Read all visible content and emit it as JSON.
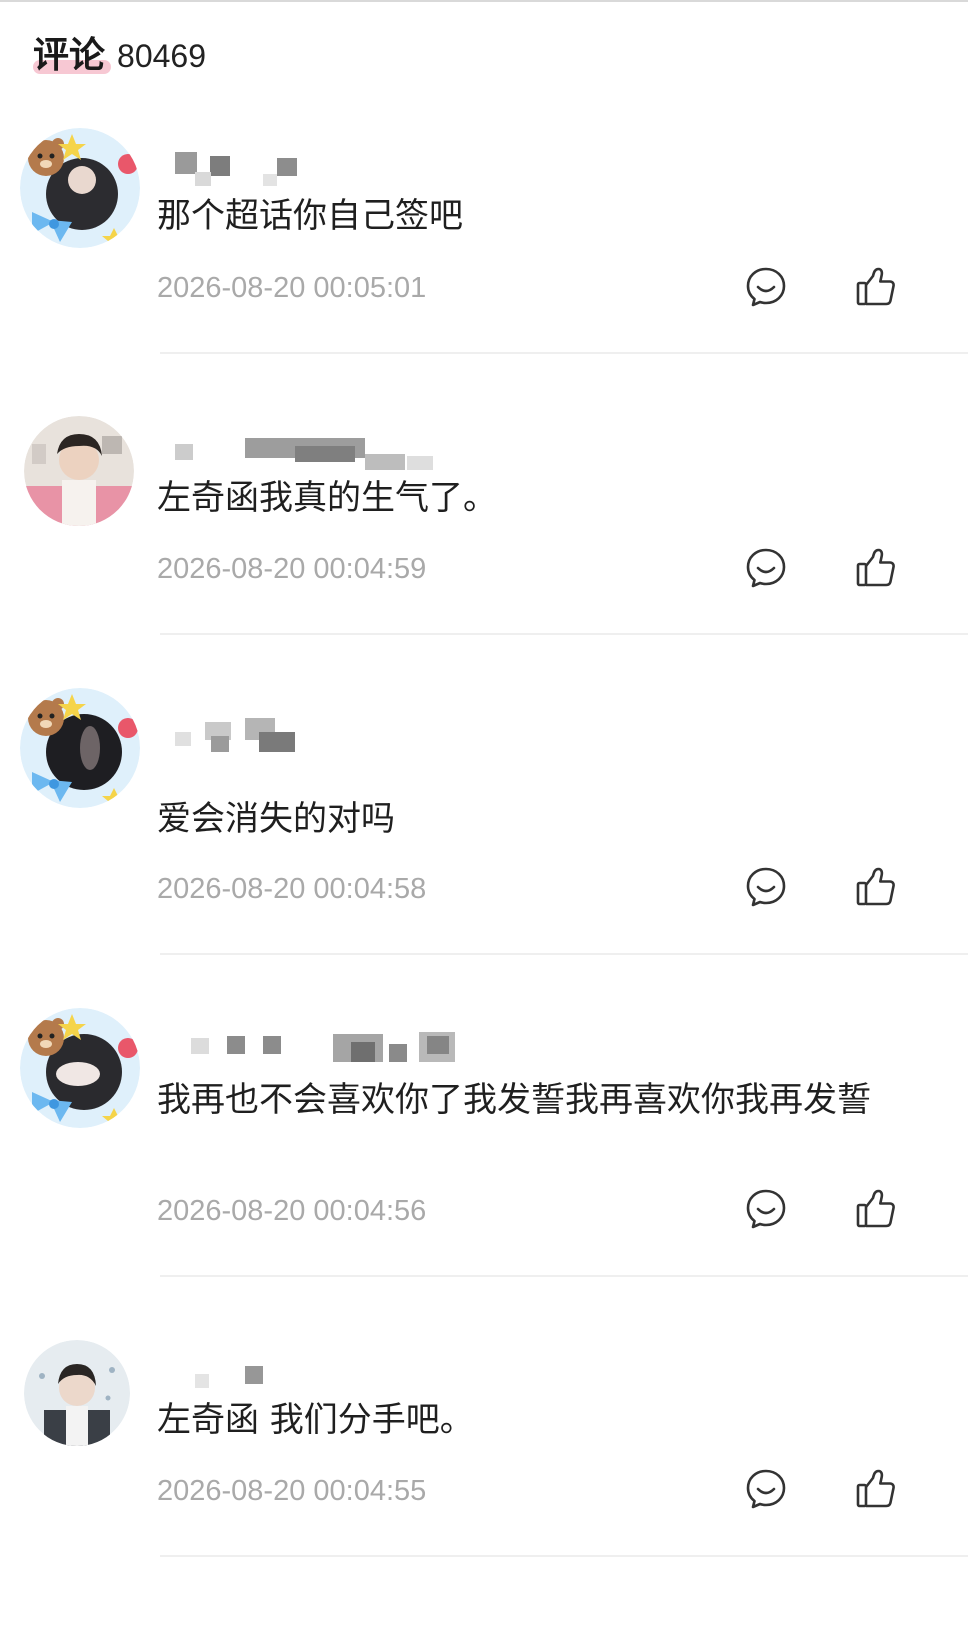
{
  "header": {
    "title": "评论",
    "count": "80469"
  },
  "comments": [
    {
      "username": "",
      "content": "那个超话你自己签吧",
      "time": "2026-08-20 00:05:01",
      "avatar_icon": "bear-frame-avatar"
    },
    {
      "username": "",
      "content": "左奇函我真的生气了。",
      "time": "2026-08-20 00:04:59",
      "avatar_icon": "photo-avatar"
    },
    {
      "username": "",
      "content": "爱会消失的对吗",
      "time": "2026-08-20 00:04:58",
      "avatar_icon": "bear-frame-avatar"
    },
    {
      "username": "",
      "content": "我再也不会喜欢你了我发誓我再喜欢你我再发誓",
      "time": "2026-08-20 00:04:56",
      "avatar_icon": "bear-frame-avatar"
    },
    {
      "username": "",
      "content": "左奇函 我们分手吧。",
      "time": "2026-08-20 00:04:55",
      "avatar_icon": "photo-avatar"
    }
  ],
  "icons": {
    "reply": "comment-bubble-icon",
    "like": "thumbs-up-icon"
  },
  "colors": {
    "accent_underline": "#f4b6c4",
    "timestamp": "#a9a9a9",
    "icon_stroke": "#333333",
    "divider": "#efefef"
  }
}
